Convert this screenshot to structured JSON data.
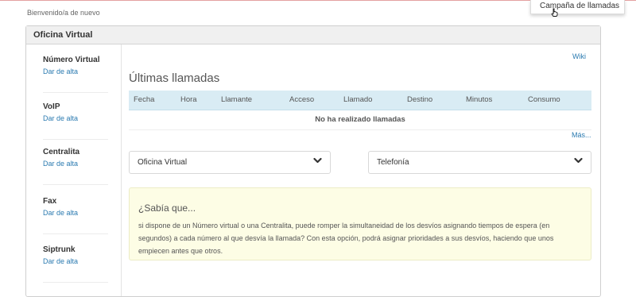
{
  "header": {
    "welcome": "Bienvenido/a de nuevo"
  },
  "dropdown": {
    "item": "Campaña de llamadas"
  },
  "panel": {
    "title": "Oficina Virtual"
  },
  "sidebar": {
    "items": [
      {
        "title": "Número Virtual",
        "link": "Dar de alta"
      },
      {
        "title": "VoIP",
        "link": "Dar de alta"
      },
      {
        "title": "Centralita",
        "link": "Dar de alta"
      },
      {
        "title": "Fax",
        "link": "Dar de alta"
      },
      {
        "title": "Siptrunk",
        "link": "Dar de alta"
      }
    ]
  },
  "main": {
    "wiki": "Wiki",
    "section_title": "Últimas llamadas",
    "columns": [
      "Fecha",
      "Hora",
      "Llamante",
      "Acceso",
      "Llamado",
      "Destino",
      "Minutos",
      "Consumo"
    ],
    "empty_message": "No ha realizado llamadas",
    "more": "Más...",
    "select_left": "Oficina Virtual",
    "select_right": "Telefonía"
  },
  "tip": {
    "title": "¿Sabía que...",
    "text": "si dispone de un Número virtual o una Centralita, puede romper la simultaneidad de los desvíos asignando tiempos de espera (en segundos) a cada número al que desvía la llamada? Con esta opción, podrá asignar prioridades a sus desvíos, haciendo que unos empiecen antes que otros."
  },
  "colors": {
    "link": "#2a7ab0",
    "table_header_bg": "#d9ecf4",
    "tip_bg": "#fdfde5"
  },
  "icons": {
    "select_arrow": "chevron-down-icon",
    "cursor": "hand-pointer-icon"
  }
}
